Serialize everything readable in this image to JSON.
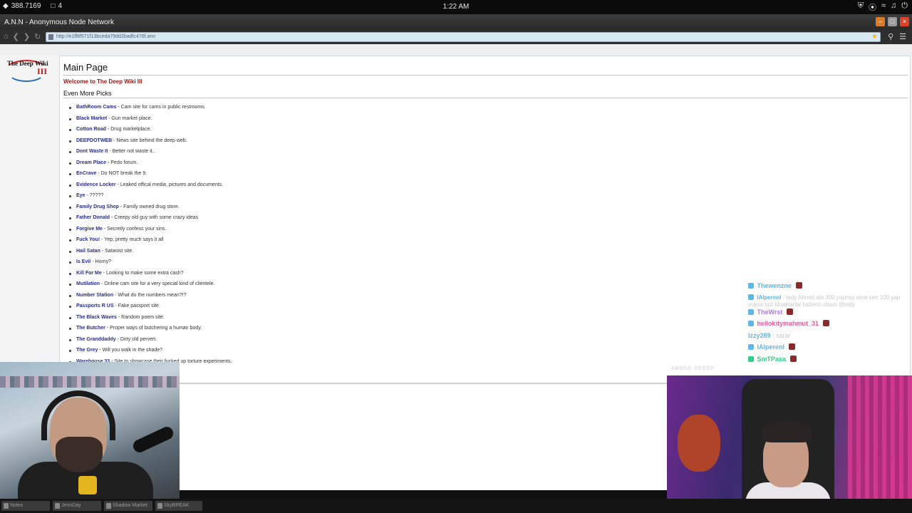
{
  "system_bar": {
    "counter_value": "388.7169",
    "window_count": "4",
    "clock": "1:22 AM"
  },
  "window": {
    "title": "A.N.N - Anonymous Node Network"
  },
  "address_bar": {
    "url": "http://e1ff8f571f13bceda79dd2badfc476f.ann"
  },
  "wiki": {
    "logo_text_main": "The Deep Wiki",
    "logo_text_numeral": "III",
    "page_title": "Main Page",
    "welcome": "Welcome to The Deep Wiki III",
    "section_heading": "Even More Picks",
    "entries": [
      {
        "name": "BathRoom Cams",
        "desc": " - Cam site for cams in public restrooms."
      },
      {
        "name": "Black Market",
        "desc": " - Gun market place."
      },
      {
        "name": "Cotton Road",
        "desc": " - Drug marketplace."
      },
      {
        "name": "DEEPDOTWEB",
        "desc": " - News site behind the deep web."
      },
      {
        "name": "Dont Waste It",
        "desc": " - Better not waste it.."
      },
      {
        "name": "Dream Place",
        "desc": " - Pedo forum."
      },
      {
        "name": "EnCrave",
        "desc": " - Do NOT break the 9."
      },
      {
        "name": "Evidence Locker",
        "desc": " - Leaked offical media, pictures and documents."
      },
      {
        "name": "Eye",
        "desc": " - ?????"
      },
      {
        "name": "Family Drug Shop",
        "desc": " - Family owned drug store."
      },
      {
        "name": "Father Donald",
        "desc": " - Creepy old guy with some crazy ideas"
      },
      {
        "name": "Forgive Me",
        "desc": " - Secretly confess your sins."
      },
      {
        "name": "Fuck You!",
        "desc": " - Yep, pretty much says it all"
      },
      {
        "name": "Hail Satan",
        "desc": " - Satanist site."
      },
      {
        "name": "Is Evil",
        "desc": " - Horny?"
      },
      {
        "name": "Kill For Me",
        "desc": " - Looking to make some extra cash?"
      },
      {
        "name": "Mutilation",
        "desc": " - Online cam site for a very special kind of clientele."
      },
      {
        "name": "Number Station",
        "desc": " - What do the numbers mean?!?"
      },
      {
        "name": "Passports R US",
        "desc": " - Fake passport site."
      },
      {
        "name": "The Black Waves",
        "desc": " - Random poem site."
      },
      {
        "name": "The Butcher",
        "desc": " - Proper ways of butchering a human body."
      },
      {
        "name": "The Granddaddy",
        "desc": " - Dirty old pervert."
      },
      {
        "name": "The Grey",
        "desc": " - Will you walk in the shade?"
      },
      {
        "name": "Warehouse 33",
        "desc": " - Site to showcase their fucked up torture experiments."
      }
    ]
  },
  "chat": {
    "messages": [
      {
        "user": "Thewenzne",
        "text": "",
        "color": "#5bb8e8"
      },
      {
        "user": "IAlperenl",
        "text": " : tedy Ahmet abi 300 yapmış ama sen 100 yap yoksa bizi bloaklarlar haberin olsun @tedy",
        "color": "#5bb8e8"
      },
      {
        "user": "TheWrst",
        "text": "",
        "color": "#b07ae8"
      },
      {
        "user": "hellokitymahmut_31",
        "text": "",
        "color": "#e85b9a"
      },
      {
        "user": "Izzy289",
        "text": " : sarar",
        "color": "#5bb8e8"
      },
      {
        "user": "IAlperenl",
        "text": "",
        "color": "#5bb8e8"
      },
      {
        "user": "SmTPasa",
        "text": "",
        "color": "#2ad08a"
      }
    ],
    "watermark": "ABONE HEDEF"
  },
  "taskbar": {
    "items": [
      "Notes",
      "JennDay",
      "Shadow Market",
      "SkyBREAK"
    ]
  }
}
